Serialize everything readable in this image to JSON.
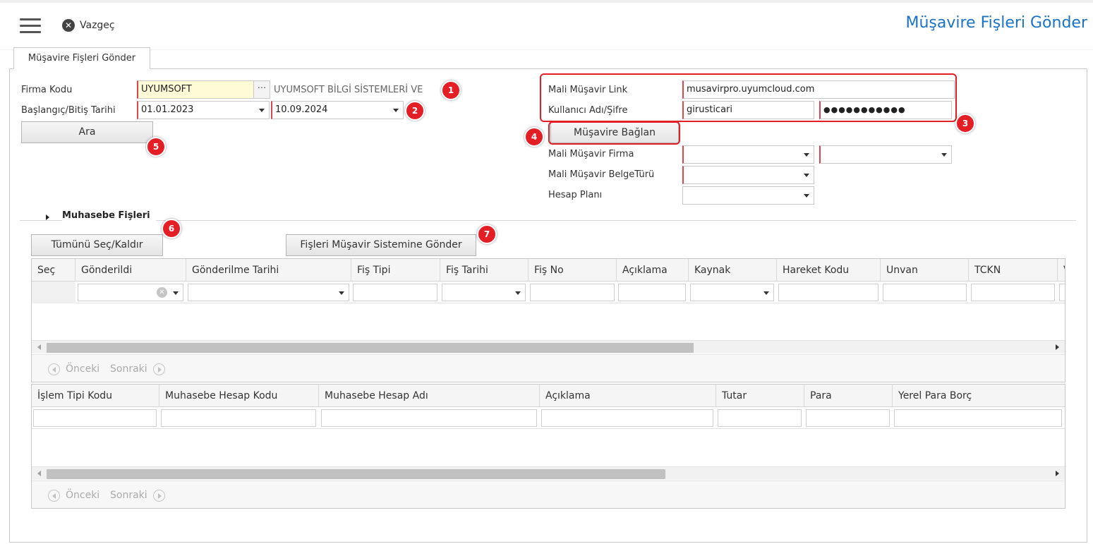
{
  "header": {
    "cancel_label": "Vazgeç",
    "title": "Müşavire Fişleri Gönder"
  },
  "tab": {
    "label": "Müşavire Fişleri Gönder"
  },
  "form_left": {
    "company_code_label": "Firma Kodu",
    "company_code_value": "UYUMSOFT",
    "company_name": "UYUMSOFT BİLGİ SİSTEMLERİ VE",
    "date_range_label": "Başlangıç/Bitiş Tarihi",
    "start_date": "01.01.2023",
    "end_date": "10.09.2024",
    "search_button": "Ara"
  },
  "form_right": {
    "link_label": "Mali Müşavir Link",
    "link_value": "musavirpro.uyumcloud.com",
    "credentials_label": "Kullanıcı Adı/Şifre",
    "username_value": "girusticari",
    "password_value": "●●●●●●●●●●●",
    "connect_button": "Müşavire Bağlan",
    "firm_label": "Mali Müşavir Firma",
    "doc_type_label": "Mali Müşavir BelgeTürü",
    "account_plan_label": "Hesap Planı"
  },
  "badges": [
    "1",
    "2",
    "3",
    "4",
    "5",
    "6",
    "7"
  ],
  "section": {
    "title": "Muhasebe Fişleri",
    "select_all_button": "Tümünü Seç/Kaldır",
    "send_button": "Fişleri Müşavir Sistemine Gönder"
  },
  "grid1": {
    "columns": [
      "Seç",
      "Gönderildi",
      "Gönderilme Tarihi",
      "Fiş Tipi",
      "Fiş Tarihi",
      "Fiş No",
      "Açıklama",
      "Kaynak",
      "Hareket Kodu",
      "Unvan",
      "TCKN",
      "V"
    ],
    "pager_prev": "Önceki",
    "pager_next": "Sonraki"
  },
  "grid2": {
    "columns": [
      "İşlem Tipi Kodu",
      "Muhasebe Hesap Kodu",
      "Muhasebe Hesap Adı",
      "Açıklama",
      "Tutar",
      "Para",
      "Yerel Para Borç"
    ],
    "pager_prev": "Önceki",
    "pager_next": "Sonraki"
  },
  "colors": {
    "title_blue": "#1a73c6",
    "badge_red": "#e31e24",
    "required_red": "#e0454f",
    "highlight_yellow": "#fffbd6"
  }
}
